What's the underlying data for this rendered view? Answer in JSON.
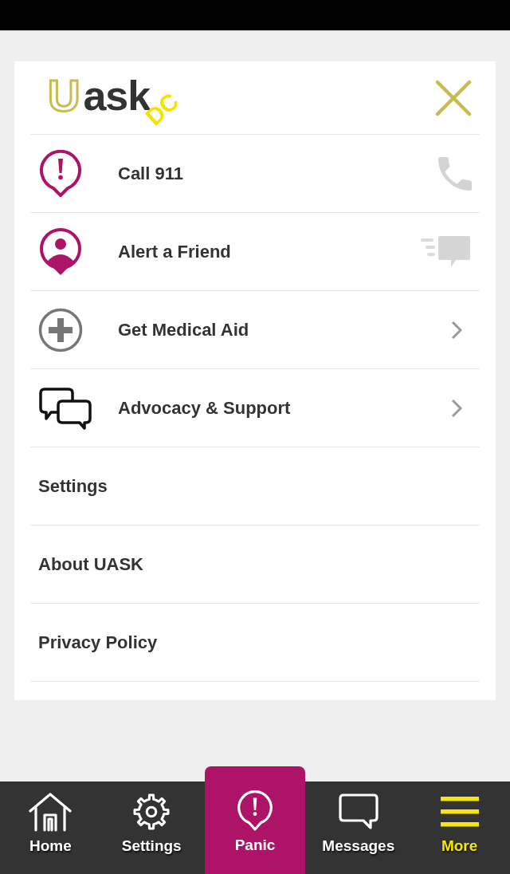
{
  "header": {
    "logo": {
      "mark": "U",
      "word": "ask",
      "region": "DC"
    }
  },
  "menu": {
    "items": [
      {
        "kind": "action",
        "label": "Call 911"
      },
      {
        "kind": "action",
        "label": "Alert a Friend"
      },
      {
        "kind": "submenu",
        "label": "Get Medical Aid"
      },
      {
        "kind": "submenu",
        "label": "Advocacy & Support"
      },
      {
        "kind": "plain",
        "label": "Settings"
      },
      {
        "kind": "plain",
        "label": "About UASK"
      },
      {
        "kind": "plain",
        "label": "Privacy Policy"
      }
    ]
  },
  "nav": {
    "items": [
      {
        "label": "Home",
        "kind": "standard",
        "selected": false
      },
      {
        "label": "Settings",
        "kind": "standard",
        "selected": false
      },
      {
        "label": "Panic",
        "kind": "panic",
        "selected": false
      },
      {
        "label": "Messages",
        "kind": "standard",
        "selected": false
      },
      {
        "label": "More",
        "kind": "standard",
        "selected": true
      }
    ]
  }
}
